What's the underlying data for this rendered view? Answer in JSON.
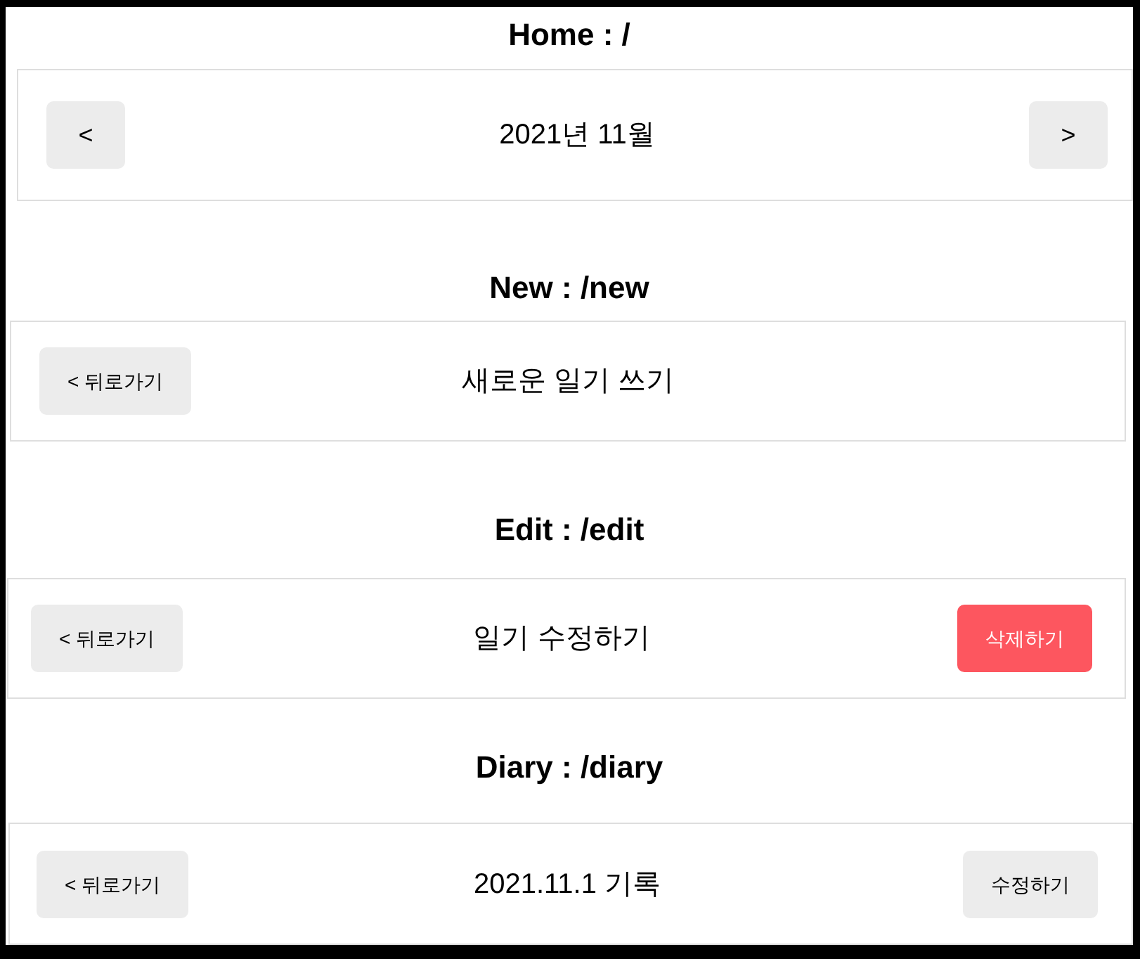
{
  "sections": [
    {
      "heading": "Home : /",
      "header": {
        "left": {
          "text": "<",
          "kind": "default"
        },
        "title": "2021년 11월",
        "right": {
          "text": ">",
          "kind": "default"
        }
      }
    },
    {
      "heading": "New : /new",
      "header": {
        "left": {
          "text": "< 뒤로가기",
          "kind": "default"
        },
        "title": "새로운 일기 쓰기"
      }
    },
    {
      "heading": "Edit : /edit",
      "header": {
        "left": {
          "text": "< 뒤로가기",
          "kind": "default"
        },
        "title": "일기 수정하기",
        "right": {
          "text": "삭제하기",
          "kind": "negative"
        }
      }
    },
    {
      "heading": "Diary : /diary",
      "header": {
        "left": {
          "text": "< 뒤로가기",
          "kind": "default"
        },
        "title": "2021.11.1 기록",
        "right": {
          "text": "수정하기",
          "kind": "default"
        }
      }
    }
  ]
}
